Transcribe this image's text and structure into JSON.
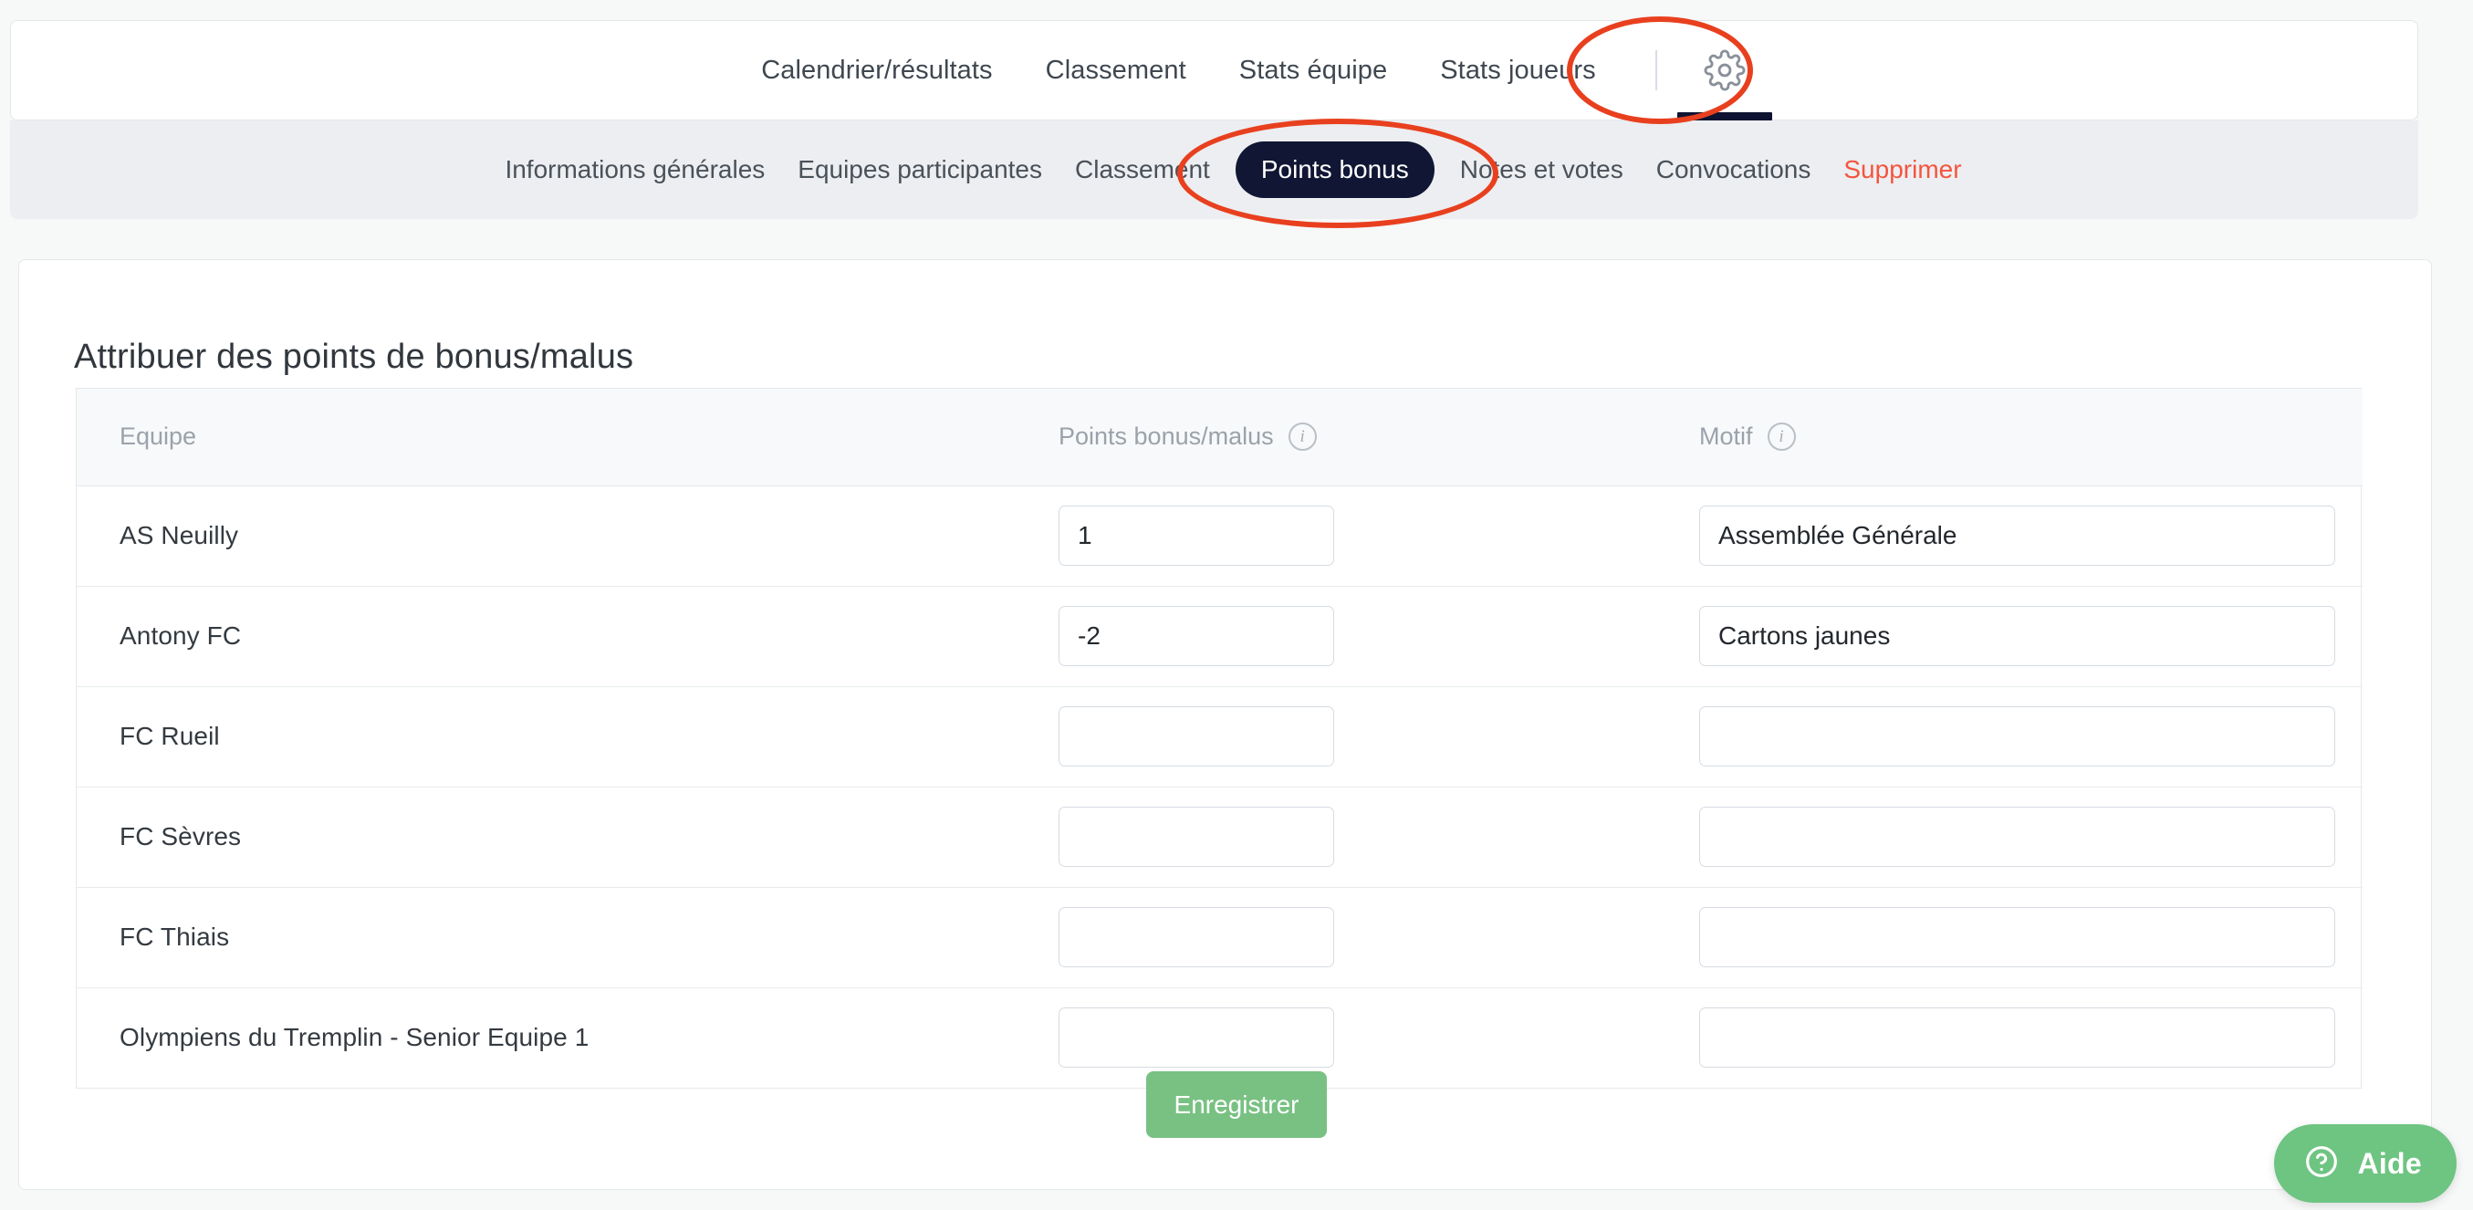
{
  "top_nav": {
    "items": [
      {
        "label": "Calendrier/résultats",
        "active": false
      },
      {
        "label": "Classement",
        "active": false
      },
      {
        "label": "Stats équipe",
        "active": false
      },
      {
        "label": "Stats joueurs",
        "active": false
      }
    ],
    "settings_icon": "gear-icon",
    "settings_active": true
  },
  "sub_nav": {
    "items": [
      {
        "label": "Informations générales",
        "style": "normal"
      },
      {
        "label": "Equipes participantes",
        "style": "normal"
      },
      {
        "label": "Classement",
        "style": "normal"
      },
      {
        "label": "Points bonus",
        "style": "active-pill"
      },
      {
        "label": "Notes et votes",
        "style": "normal"
      },
      {
        "label": "Convocations",
        "style": "normal"
      },
      {
        "label": "Supprimer",
        "style": "danger"
      }
    ]
  },
  "main": {
    "title": "Attribuer des points de bonus/malus",
    "table": {
      "headers": {
        "team": "Equipe",
        "points": "Points bonus/malus",
        "motif": "Motif"
      },
      "header_info_icons": {
        "points": "info-icon",
        "motif": "info-icon"
      },
      "rows": [
        {
          "team": "AS Neuilly",
          "points": "1",
          "motif": "Assemblée Générale"
        },
        {
          "team": "Antony FC",
          "points": "-2",
          "motif": "Cartons jaunes"
        },
        {
          "team": "FC Rueil",
          "points": "",
          "motif": ""
        },
        {
          "team": "FC Sèvres",
          "points": "",
          "motif": ""
        },
        {
          "team": "FC Thiais",
          "points": "",
          "motif": ""
        },
        {
          "team": "Olympiens du Tremplin - Senior Equipe 1",
          "points": "",
          "motif": ""
        }
      ]
    },
    "save_label": "Enregistrer"
  },
  "help_widget": {
    "label": "Aide",
    "icon": "question-mark-circle-icon"
  },
  "annotations": [
    {
      "name": "gear-highlight",
      "target": "settings-gear"
    },
    {
      "name": "points-bonus-highlight",
      "target": "sub-nav-points-bonus"
    }
  ],
  "colors": {
    "accent_dark": "#111634",
    "danger": "#f4553d",
    "green": "#79c183",
    "annotation_red": "#e8401f",
    "page_bg": "#f7f8f8",
    "subnav_bg": "#eceef1"
  }
}
